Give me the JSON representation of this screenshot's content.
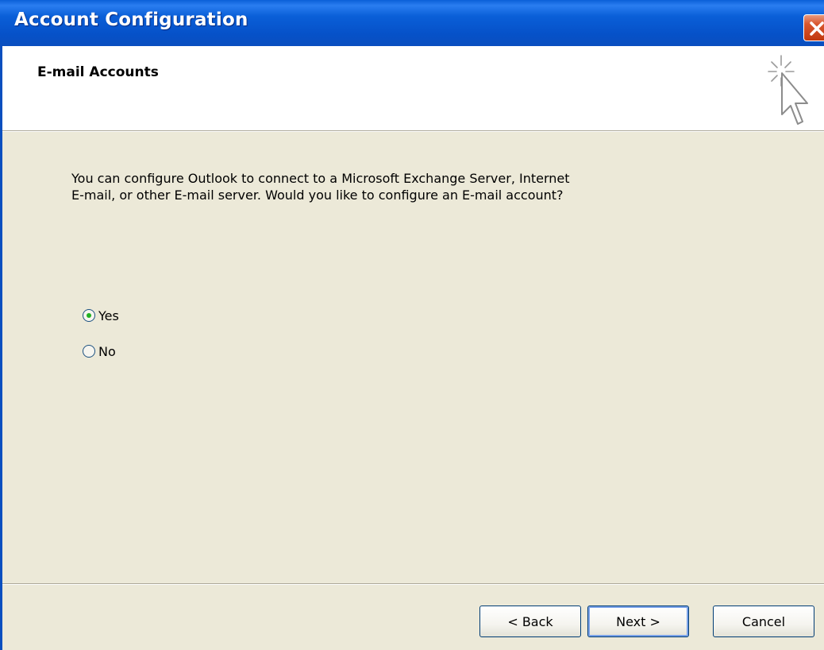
{
  "window": {
    "title": "Account Configuration"
  },
  "header": {
    "title": "E-mail Accounts",
    "icon": "wizard-cursor-icon"
  },
  "content": {
    "prompt": "You can configure Outlook to connect to a Microsoft Exchange Server, Internet\nE-mail, or other E-mail server.  Would you like to configure an E-mail account?",
    "options": [
      {
        "label": "Yes",
        "selected": true
      },
      {
        "label": "No",
        "selected": false
      }
    ]
  },
  "buttons": {
    "back_label": "< Back",
    "next_label": "Next >",
    "cancel_label": "Cancel"
  },
  "colors": {
    "titlebar": "#0a5fd8",
    "background": "#ece9d8",
    "radio_selected": "#22b122",
    "close_button": "#d9572f"
  }
}
